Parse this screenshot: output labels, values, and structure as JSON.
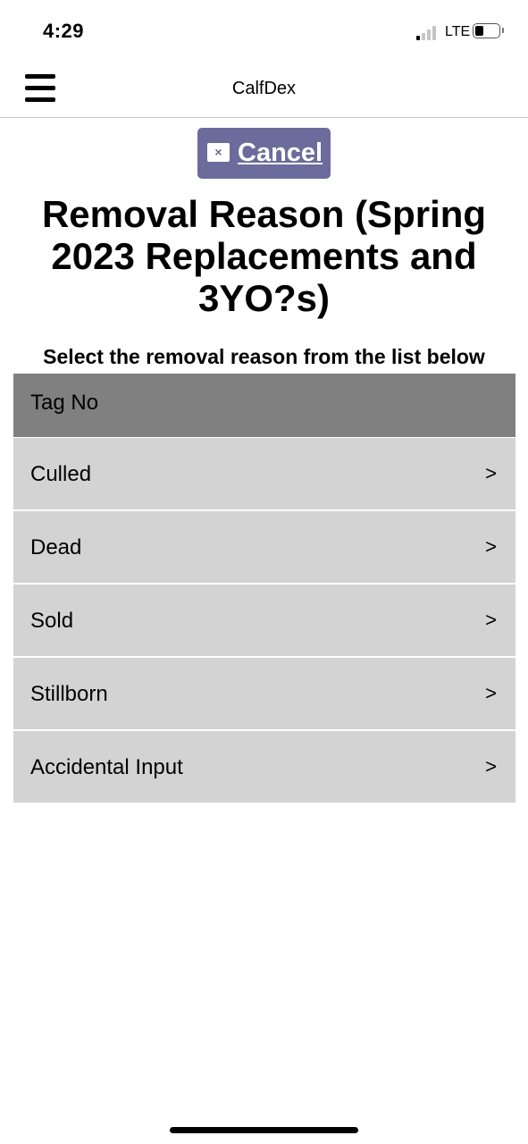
{
  "status_bar": {
    "time": "4:29",
    "network": "LTE",
    "signal_bars_active": 1,
    "signal_bars_total": 4,
    "battery_level": 0.3
  },
  "nav": {
    "title": "CalfDex",
    "menu_icon": "hamburger-menu-icon"
  },
  "cancel": {
    "label": "Cancel",
    "icon": "close-icon",
    "icon_glyph": "×",
    "color": "#6b6b9c"
  },
  "page": {
    "title": "Removal Reason (Spring 2023 Replacements and 3YO?s)",
    "instruction": "Select the removal reason from the list below"
  },
  "list": {
    "header": "Tag No",
    "header_color": "#808080",
    "item_color": "#d3d3d3",
    "items": [
      {
        "label": "Culled",
        "arrow": ">"
      },
      {
        "label": "Dead",
        "arrow": ">"
      },
      {
        "label": "Sold",
        "arrow": ">"
      },
      {
        "label": "Stillborn",
        "arrow": ">"
      },
      {
        "label": "Accidental Input",
        "arrow": ">"
      }
    ]
  }
}
